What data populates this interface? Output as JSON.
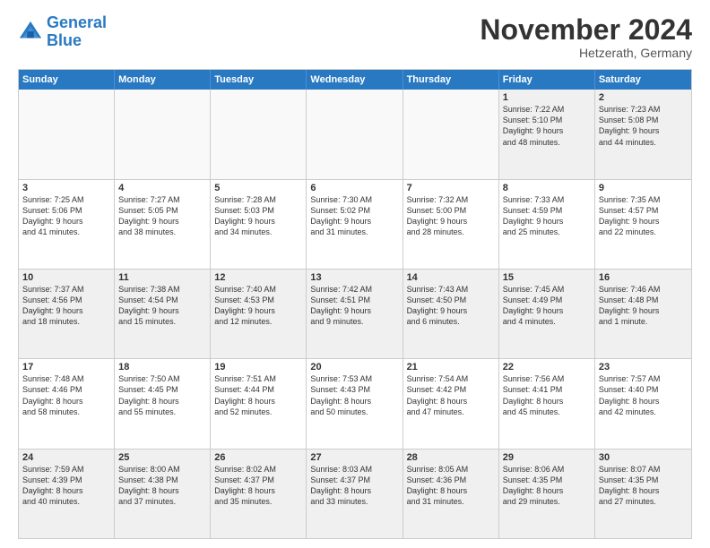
{
  "logo": {
    "line1": "General",
    "line2": "Blue"
  },
  "title": "November 2024",
  "subtitle": "Hetzerath, Germany",
  "days": [
    "Sunday",
    "Monday",
    "Tuesday",
    "Wednesday",
    "Thursday",
    "Friday",
    "Saturday"
  ],
  "rows": [
    [
      {
        "day": "",
        "info": ""
      },
      {
        "day": "",
        "info": ""
      },
      {
        "day": "",
        "info": ""
      },
      {
        "day": "",
        "info": ""
      },
      {
        "day": "",
        "info": ""
      },
      {
        "day": "1",
        "info": "Sunrise: 7:22 AM\nSunset: 5:10 PM\nDaylight: 9 hours\nand 48 minutes."
      },
      {
        "day": "2",
        "info": "Sunrise: 7:23 AM\nSunset: 5:08 PM\nDaylight: 9 hours\nand 44 minutes."
      }
    ],
    [
      {
        "day": "3",
        "info": "Sunrise: 7:25 AM\nSunset: 5:06 PM\nDaylight: 9 hours\nand 41 minutes."
      },
      {
        "day": "4",
        "info": "Sunrise: 7:27 AM\nSunset: 5:05 PM\nDaylight: 9 hours\nand 38 minutes."
      },
      {
        "day": "5",
        "info": "Sunrise: 7:28 AM\nSunset: 5:03 PM\nDaylight: 9 hours\nand 34 minutes."
      },
      {
        "day": "6",
        "info": "Sunrise: 7:30 AM\nSunset: 5:02 PM\nDaylight: 9 hours\nand 31 minutes."
      },
      {
        "day": "7",
        "info": "Sunrise: 7:32 AM\nSunset: 5:00 PM\nDaylight: 9 hours\nand 28 minutes."
      },
      {
        "day": "8",
        "info": "Sunrise: 7:33 AM\nSunset: 4:59 PM\nDaylight: 9 hours\nand 25 minutes."
      },
      {
        "day": "9",
        "info": "Sunrise: 7:35 AM\nSunset: 4:57 PM\nDaylight: 9 hours\nand 22 minutes."
      }
    ],
    [
      {
        "day": "10",
        "info": "Sunrise: 7:37 AM\nSunset: 4:56 PM\nDaylight: 9 hours\nand 18 minutes."
      },
      {
        "day": "11",
        "info": "Sunrise: 7:38 AM\nSunset: 4:54 PM\nDaylight: 9 hours\nand 15 minutes."
      },
      {
        "day": "12",
        "info": "Sunrise: 7:40 AM\nSunset: 4:53 PM\nDaylight: 9 hours\nand 12 minutes."
      },
      {
        "day": "13",
        "info": "Sunrise: 7:42 AM\nSunset: 4:51 PM\nDaylight: 9 hours\nand 9 minutes."
      },
      {
        "day": "14",
        "info": "Sunrise: 7:43 AM\nSunset: 4:50 PM\nDaylight: 9 hours\nand 6 minutes."
      },
      {
        "day": "15",
        "info": "Sunrise: 7:45 AM\nSunset: 4:49 PM\nDaylight: 9 hours\nand 4 minutes."
      },
      {
        "day": "16",
        "info": "Sunrise: 7:46 AM\nSunset: 4:48 PM\nDaylight: 9 hours\nand 1 minute."
      }
    ],
    [
      {
        "day": "17",
        "info": "Sunrise: 7:48 AM\nSunset: 4:46 PM\nDaylight: 8 hours\nand 58 minutes."
      },
      {
        "day": "18",
        "info": "Sunrise: 7:50 AM\nSunset: 4:45 PM\nDaylight: 8 hours\nand 55 minutes."
      },
      {
        "day": "19",
        "info": "Sunrise: 7:51 AM\nSunset: 4:44 PM\nDaylight: 8 hours\nand 52 minutes."
      },
      {
        "day": "20",
        "info": "Sunrise: 7:53 AM\nSunset: 4:43 PM\nDaylight: 8 hours\nand 50 minutes."
      },
      {
        "day": "21",
        "info": "Sunrise: 7:54 AM\nSunset: 4:42 PM\nDaylight: 8 hours\nand 47 minutes."
      },
      {
        "day": "22",
        "info": "Sunrise: 7:56 AM\nSunset: 4:41 PM\nDaylight: 8 hours\nand 45 minutes."
      },
      {
        "day": "23",
        "info": "Sunrise: 7:57 AM\nSunset: 4:40 PM\nDaylight: 8 hours\nand 42 minutes."
      }
    ],
    [
      {
        "day": "24",
        "info": "Sunrise: 7:59 AM\nSunset: 4:39 PM\nDaylight: 8 hours\nand 40 minutes."
      },
      {
        "day": "25",
        "info": "Sunrise: 8:00 AM\nSunset: 4:38 PM\nDaylight: 8 hours\nand 37 minutes."
      },
      {
        "day": "26",
        "info": "Sunrise: 8:02 AM\nSunset: 4:37 PM\nDaylight: 8 hours\nand 35 minutes."
      },
      {
        "day": "27",
        "info": "Sunrise: 8:03 AM\nSunset: 4:37 PM\nDaylight: 8 hours\nand 33 minutes."
      },
      {
        "day": "28",
        "info": "Sunrise: 8:05 AM\nSunset: 4:36 PM\nDaylight: 8 hours\nand 31 minutes."
      },
      {
        "day": "29",
        "info": "Sunrise: 8:06 AM\nSunset: 4:35 PM\nDaylight: 8 hours\nand 29 minutes."
      },
      {
        "day": "30",
        "info": "Sunrise: 8:07 AM\nSunset: 4:35 PM\nDaylight: 8 hours\nand 27 minutes."
      }
    ]
  ]
}
